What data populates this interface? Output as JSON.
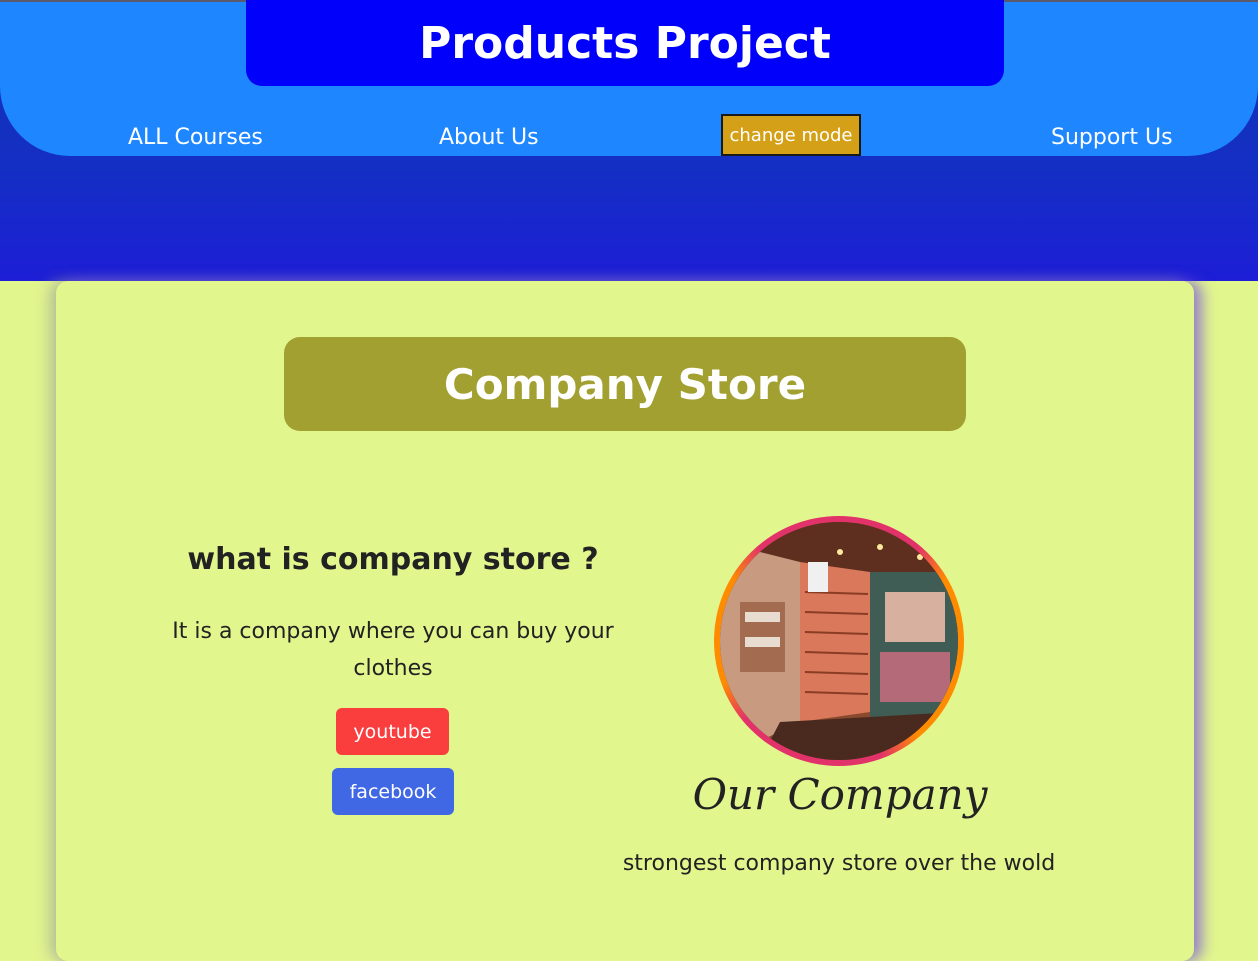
{
  "header": {
    "title": "Products Project",
    "nav": {
      "all_courses": "ALL Courses",
      "about_us": "About Us",
      "change_mode": "change mode",
      "support_us": "Support Us"
    }
  },
  "store": {
    "banner": "Company Store",
    "question": "what is company store ?",
    "description": "It is a company where you can buy your clothes",
    "buttons": {
      "youtube": "youtube",
      "facebook": "facebook"
    },
    "company_title": "Our Company",
    "company_subtitle": "strongest company store over the wold"
  },
  "colors": {
    "nav_band": "#1e86ff",
    "title_box": "#0000fb",
    "mode_button": "#d4a017",
    "page_background": "#e2f68e",
    "banner": "#a3a032",
    "youtube": "#fa3e3e",
    "facebook": "#4067e4"
  }
}
